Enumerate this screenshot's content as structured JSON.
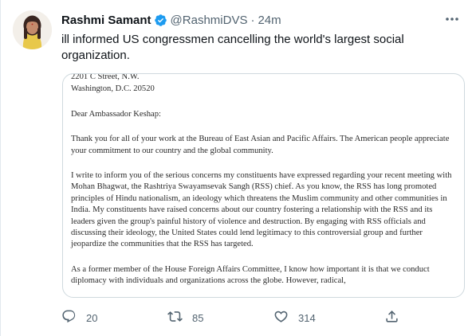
{
  "tweet": {
    "author_name": "Rashmi Samant",
    "handle": "@RashmiDVS",
    "separator": "·",
    "timestamp": "24m",
    "text": "ill informed US congressmen cancelling the world's largest social organization."
  },
  "icons": {
    "verified": "verified-badge-icon",
    "more": "more-icon",
    "reply": "reply-icon",
    "retweet": "retweet-icon",
    "like": "like-icon",
    "share": "share-icon"
  },
  "colors": {
    "verified": "#1d9bf0",
    "text_primary": "#0f1419",
    "text_secondary": "#536471",
    "border": "#cfd9de"
  },
  "letter": {
    "address_line1": "2201 C Street, N.W.",
    "address_line2": "Washington, D.C. 20520",
    "salutation": "Dear Ambassador Keshap:",
    "paragraph1": "Thank you for all of your work at the Bureau of East Asian and Pacific Affairs. The American people appreciate your commitment to our country and the global community.",
    "paragraph2": "I write to inform you of the serious concerns my constituents have expressed regarding your recent meeting with Mohan Bhagwat, the Rashtriya Swayamsevak Sangh (RSS) chief. As you know, the RSS has long promoted principles of Hindu nationalism, an ideology which threatens the Muslim community and other communities in India. My constituents have raised concerns about our country fostering a relationship with the RSS and its leaders given the group's painful history of violence and destruction. By engaging with RSS officials and discussing their ideology, the United States could lend legitimacy to this controversial group and further jeopardize the communities that the RSS has targeted.",
    "paragraph3": "As a former member of the House Foreign Affairs Committee, I know how important it is that we conduct diplomacy with individuals and organizations across the globe. However, radical,"
  },
  "actions": {
    "replies": "20",
    "retweets": "85",
    "likes": "314"
  }
}
